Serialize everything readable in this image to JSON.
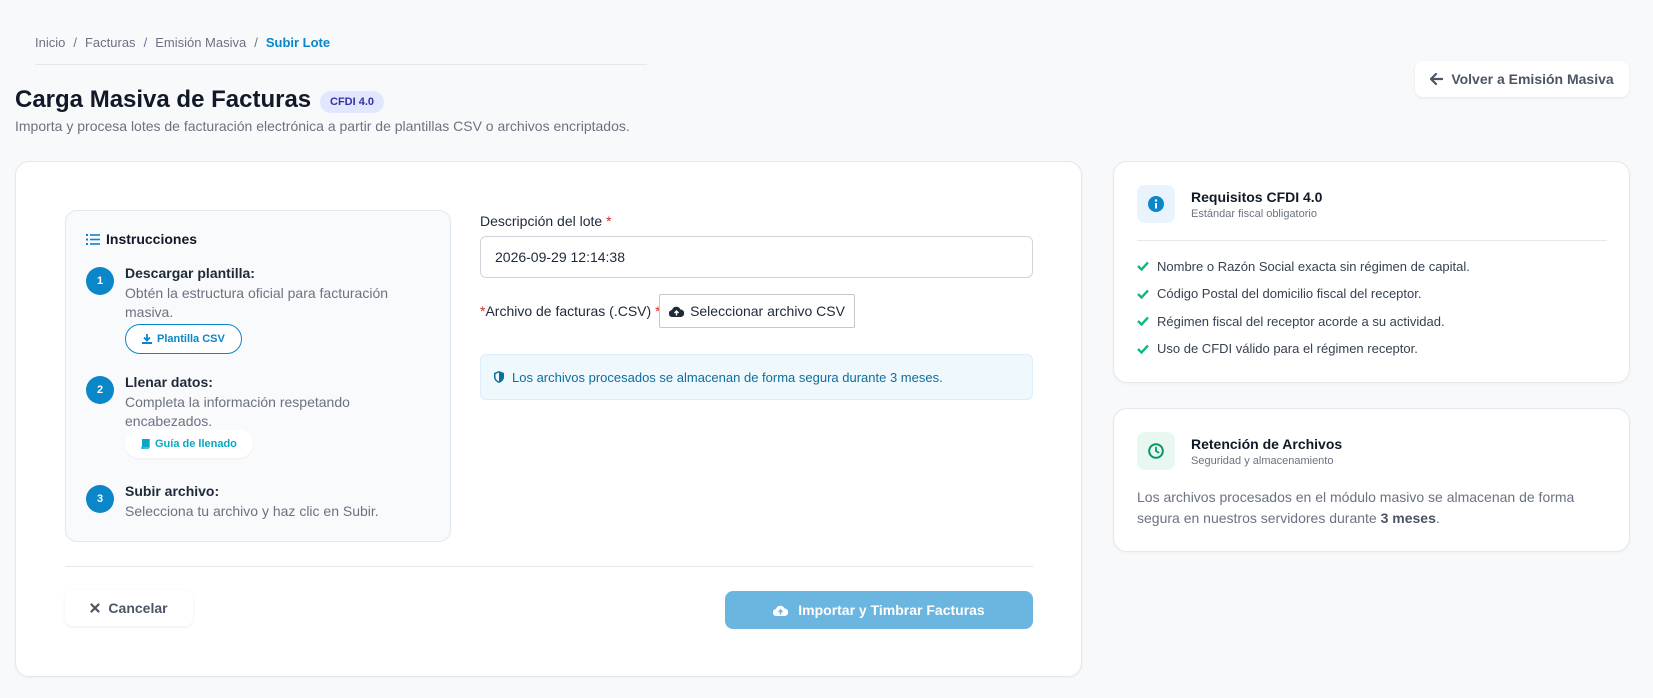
{
  "breadcrumb": {
    "items": [
      "Inicio",
      "Facturas",
      "Emisión Masiva"
    ],
    "separator": "/",
    "current": "Subir Lote"
  },
  "header": {
    "title": "Carga Masiva de Facturas",
    "badge": "CFDI 4.0",
    "subtitle": "Importa y procesa lotes de facturación electrónica a partir de plantillas CSV o archivos encriptados.",
    "back_label": "Volver a Emisión Masiva"
  },
  "instructions": {
    "title": "Instrucciones",
    "steps": [
      {
        "num": "1",
        "title": "Descargar plantilla:",
        "desc": "Obtén la estructura oficial para facturación masiva.",
        "action": "Plantilla CSV"
      },
      {
        "num": "2",
        "title": "Llenar datos:",
        "desc": "Completa la información respetando encabezados.",
        "action": "Guía de llenado"
      },
      {
        "num": "3",
        "title": "Subir archivo:",
        "desc": "Selecciona tu archivo y haz clic en Subir."
      }
    ]
  },
  "form": {
    "description_label": "Descripción del lote",
    "description_value": "2026-09-29 12:14:38",
    "required_mark": "*",
    "file_label": "Archivo de facturas (.CSV)",
    "file_button": "Seleccionar archivo CSV",
    "notice": "Los archivos procesados se almacenan de forma segura durante 3 meses.",
    "cancel_label": "Cancelar",
    "submit_label": "Importar y Timbrar Facturas"
  },
  "requirements": {
    "title": "Requisitos CFDI 4.0",
    "subtitle": "Estándar fiscal obligatorio",
    "items": [
      "Nombre o Razón Social exacta sin régimen de capital.",
      "Código Postal del domicilio fiscal del receptor.",
      "Régimen fiscal del receptor acorde a su actividad.",
      "Uso de CFDI válido para el régimen receptor."
    ]
  },
  "retention": {
    "title": "Retención de Archivos",
    "subtitle": "Seguridad y almacenamiento",
    "text_before": "Los archivos procesados en el módulo masivo se almacenan de forma segura en nuestros servidores durante ",
    "text_bold": "3 meses",
    "text_after": "."
  },
  "colors": {
    "primary": "#0a86c9",
    "submit_disabled": "#6bb6e0",
    "success": "#10b981",
    "required": "#dc2626",
    "badge_bg": "#e0e7ff"
  },
  "icons": {
    "back": "arrow-left-icon",
    "instructions": "list-ol-icon",
    "download": "download-icon",
    "guide": "book-icon",
    "upload": "cloud-upload-icon",
    "shield": "shield-icon",
    "cancel": "x-icon",
    "info": "info-circle-icon",
    "check": "check-icon",
    "clock": "clock-icon"
  }
}
